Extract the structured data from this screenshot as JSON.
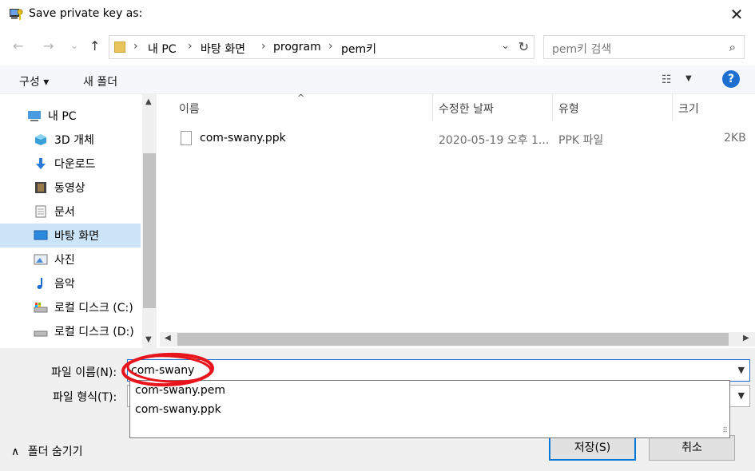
{
  "window": {
    "title": "Save private key as:",
    "close_glyph": "✕"
  },
  "nav": {
    "back_glyph": "←",
    "forward_glyph": "→",
    "history_glyph": "⌄",
    "up_glyph": "↑",
    "breadcrumbs": [
      "내 PC",
      "바탕 화면",
      "program",
      "pem키"
    ],
    "sep_glyph": "›",
    "dropdown_glyph": "⌄",
    "refresh_glyph": "↻",
    "search_placeholder": "pem키 검색",
    "search_glyph": "⌕"
  },
  "toolbar": {
    "organize_label": "구성 ▾",
    "new_folder_label": "새 폴더",
    "view_glyph": "☷",
    "view_drop_glyph": "▼",
    "help_label": "?"
  },
  "sidebar": {
    "items": [
      {
        "label": "내 PC",
        "icon": "pc-icon"
      },
      {
        "label": "3D 개체",
        "icon": "3d-objects-icon"
      },
      {
        "label": "다운로드",
        "icon": "download-icon"
      },
      {
        "label": "동영상",
        "icon": "video-icon"
      },
      {
        "label": "문서",
        "icon": "document-icon"
      },
      {
        "label": "바탕 화면",
        "icon": "desktop-icon"
      },
      {
        "label": "사진",
        "icon": "picture-icon"
      },
      {
        "label": "음악",
        "icon": "music-icon"
      },
      {
        "label": "로컬 디스크 (C:)",
        "icon": "drive-icon"
      },
      {
        "label": "로컬 디스크 (D:)",
        "icon": "drive-icon"
      }
    ],
    "selected_index": 5
  },
  "file_list": {
    "columns": [
      "이름",
      "수정한 날짜",
      "유형",
      "크기"
    ],
    "rows": [
      {
        "name": "com-swany.ppk",
        "modified": "2020-05-19 오후 1...",
        "type": "PPK 파일",
        "size": "2KB"
      }
    ]
  },
  "form": {
    "filename_label": "파일 이름(N):",
    "filename_value": "com-swany",
    "filetype_label": "파일 형식(T):",
    "folder_toggle_label": "폴더 숨기기",
    "save_label": "저장(S)",
    "cancel_label": "취소"
  },
  "autocomplete": {
    "items": [
      "com-swany.pem",
      "com-swany.ppk"
    ]
  },
  "colors": {
    "accent": "#0078d7",
    "selection": "#cce4f7",
    "annotation": "#e8141c"
  }
}
